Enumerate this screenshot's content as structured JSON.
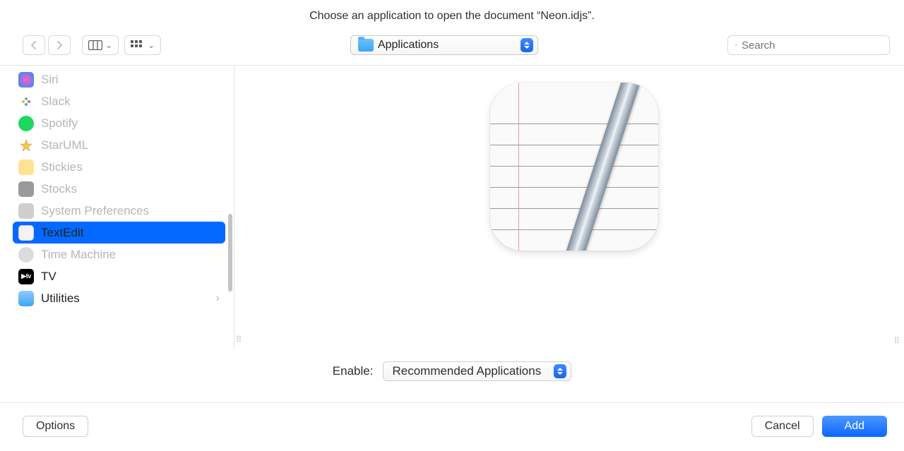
{
  "title": "Choose an application to open the document “Neon.idjs”.",
  "location": {
    "label": "Applications"
  },
  "search": {
    "placeholder": "Search"
  },
  "apps": [
    {
      "name": "Siri",
      "icon": "siri",
      "enabled": false
    },
    {
      "name": "Slack",
      "icon": "slack",
      "enabled": false
    },
    {
      "name": "Spotify",
      "icon": "spotify",
      "enabled": false
    },
    {
      "name": "StarUML",
      "icon": "staruml",
      "enabled": false
    },
    {
      "name": "Stickies",
      "icon": "stickies",
      "enabled": false
    },
    {
      "name": "Stocks",
      "icon": "stocks",
      "enabled": false
    },
    {
      "name": "System Preferences",
      "icon": "syspref",
      "enabled": false
    },
    {
      "name": "TextEdit",
      "icon": "textedit",
      "enabled": true,
      "selected": true
    },
    {
      "name": "Time Machine",
      "icon": "timemachine",
      "enabled": false
    },
    {
      "name": "TV",
      "icon": "tv",
      "enabled": true
    },
    {
      "name": "Utilities",
      "icon": "utilities",
      "enabled": true,
      "folder": true
    }
  ],
  "enable": {
    "label": "Enable:",
    "value": "Recommended Applications"
  },
  "buttons": {
    "options": "Options",
    "cancel": "Cancel",
    "add": "Add"
  }
}
